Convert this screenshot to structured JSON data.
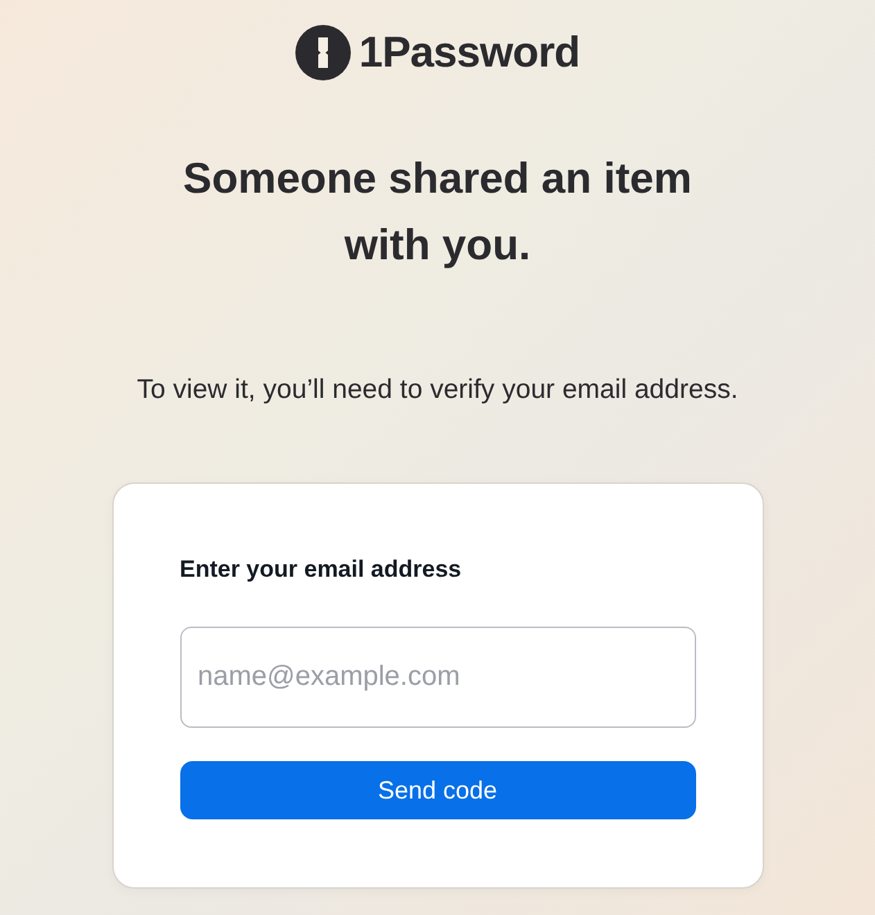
{
  "logo": {
    "text": "1Password"
  },
  "heading": "Someone shared an item with you.",
  "subtitle": "To view it, you’ll need to verify your email address.",
  "form": {
    "label": "Enter your email address",
    "email_field": {
      "placeholder": "name@example.com"
    },
    "button": "Send code"
  }
}
